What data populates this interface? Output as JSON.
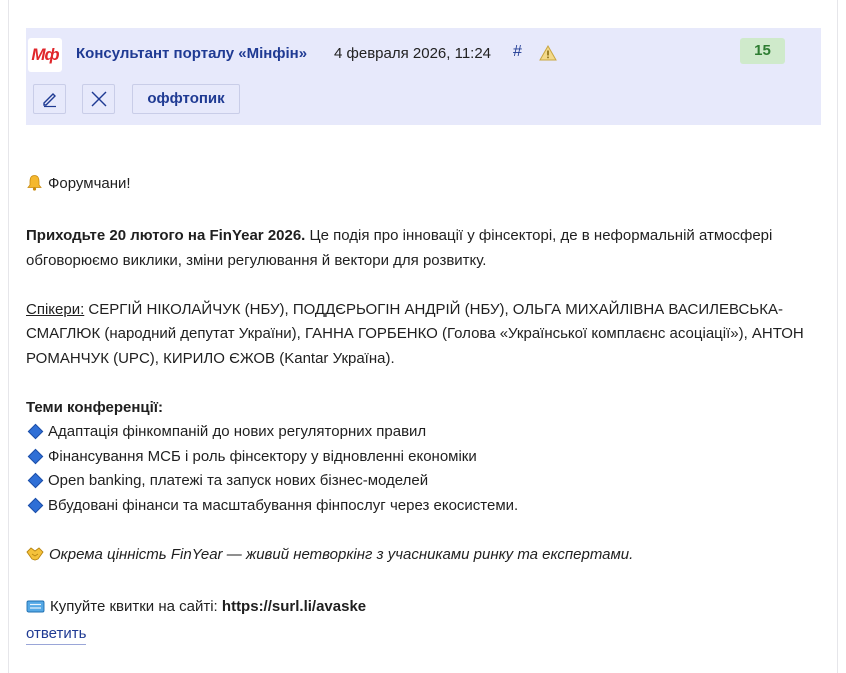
{
  "post": {
    "logo_text": "Мф",
    "author": "Консультант порталу «Мінфін»",
    "date": "4 февраля 2026, 11:24",
    "hash": "#",
    "count": "15",
    "offtopic_label": "оффтопик",
    "icons": [
      "edit-icon",
      "close-icon",
      "warning-icon",
      "bell-icon",
      "handshake-icon",
      "ticket-icon"
    ],
    "colors": {
      "accent": "#1f3a93",
      "header_bg": "#e7e9fb",
      "count_bg": "#cfeacb",
      "logo_red": "#e0262b"
    }
  },
  "content": {
    "greeting": "Форумчани!",
    "intro_bold": "Приходьте 20 лютого на FinYear 2026.",
    "intro_rest": " Це подія про інновації у фінсекторі, де в неформальній атмосфері обговорюємо виклики, зміни регулювання й вектори для розвитку.",
    "speakers_label": "Спікери:",
    "speakers_text": " СЕРГІЙ НІКОЛАЙЧУК (НБУ), ПОДДЄРЬОГІН АНДРІЙ (НБУ), ОЛЬГА МИХАЙЛІВНА ВАСИЛЕВСЬКА-СМАГЛЮК (народний депутат України), ГАННА ГОРБЕНКО (Голова «Української комплаєнс асоціації»), АНТОН РОМАНЧУК (UPC), КИРИЛО ЄЖОВ (Kantar Україна).",
    "topics_title": "Теми конференції:",
    "topics": [
      "Адаптація фінкомпаній до нових регуляторних правил",
      "Фінансування МСБ і роль фінсектору у відновленні економіки",
      "Open banking, платежі та запуск нових бізнес-моделей",
      "Вбудовані фінанси та масштабування фінпослуг через екосистеми."
    ],
    "networking": "Окрема цінність FinYear — живий нетворкінг з учасниками ринку та експертами.",
    "tickets_label": "Купуйте квитки на сайті: ",
    "tickets_link": "https://surl.li/avaske"
  },
  "reply_label": "ответить"
}
